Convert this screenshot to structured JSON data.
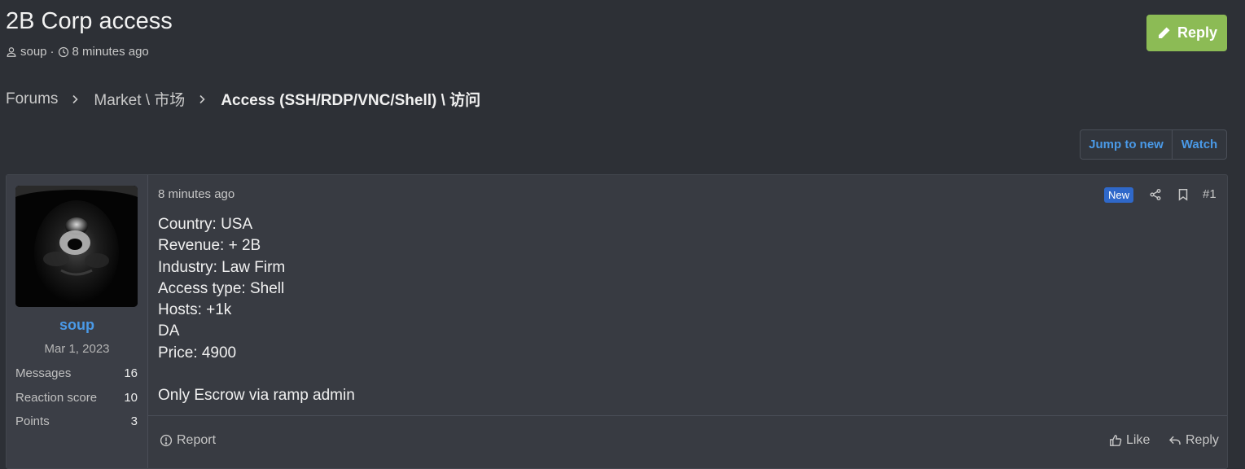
{
  "thread": {
    "title": "2B Corp access",
    "author": "soup",
    "meta_separator": "·",
    "time": "8 minutes ago"
  },
  "actions": {
    "reply_label": "Reply"
  },
  "breadcrumbs": [
    "Forums",
    "Market \\ 市场",
    "Access (SSH/RDP/VNC/Shell) \\ 访问"
  ],
  "thread_tools": {
    "jump_label": "Jump to new",
    "watch_label": "Watch"
  },
  "post": {
    "time": "8 minutes ago",
    "badge": "New",
    "number": "#1",
    "lines": [
      "Country: USA",
      "Revenue: + 2B",
      "Industry: Law Firm",
      "Access type: Shell",
      "Hosts: +1k",
      "DA",
      "Price: 4900",
      "Only Escrow via ramp admin"
    ],
    "footer": {
      "report": "Report",
      "like": "Like",
      "reply": "Reply"
    }
  },
  "user": {
    "name": "soup",
    "join_date": "Mar 1, 2023",
    "stats": [
      {
        "label": "Messages",
        "value": "16"
      },
      {
        "label": "Reaction score",
        "value": "10"
      },
      {
        "label": "Points",
        "value": "3"
      }
    ]
  },
  "colors": {
    "background": "#2d3036",
    "accent": "#4a9ae8",
    "reply_button": "#8cbb55",
    "badge": "#2f68c9"
  }
}
